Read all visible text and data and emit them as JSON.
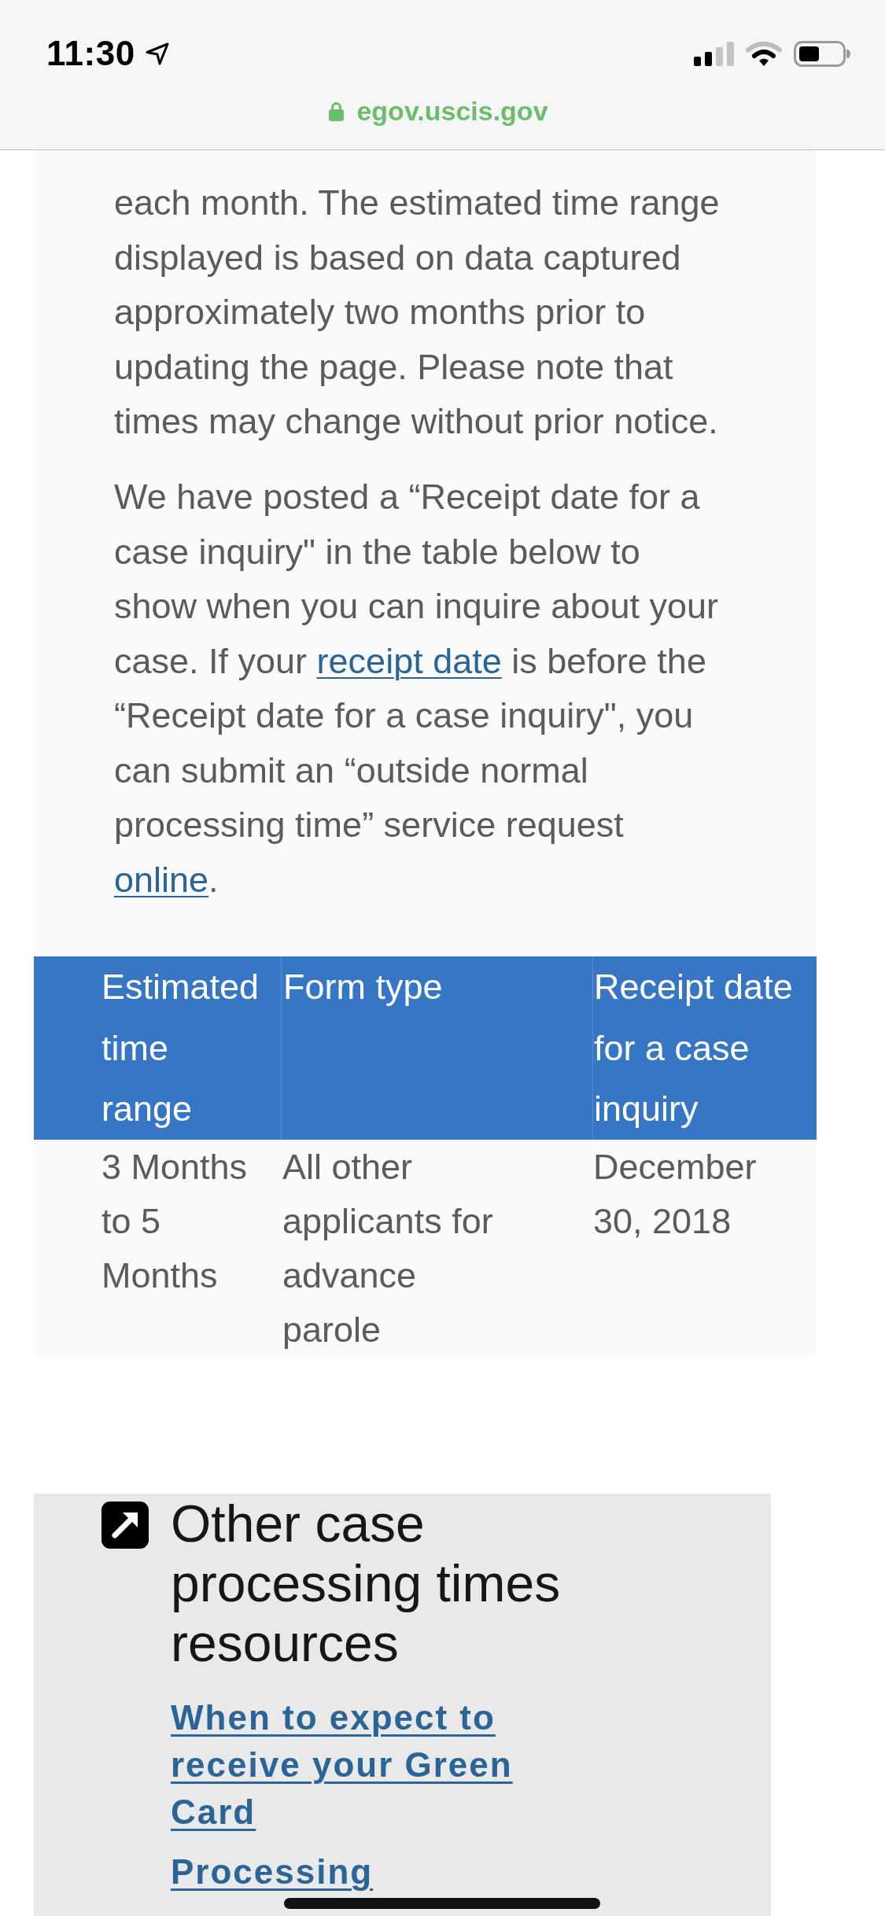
{
  "status_bar": {
    "time": "11:30"
  },
  "address_bar": {
    "url": "egov.uscis.gov"
  },
  "intro": {
    "paragraphs": [
      {
        "segments": [
          {
            "kind": "text",
            "text": "each month. The estimated time range displayed is based on data captured approximately two months prior to updating the page. Please note that times may change without prior notice."
          }
        ]
      },
      {
        "segments": [
          {
            "kind": "text",
            "text": "We have posted a “Receipt date for a case inquiry\" in the table below to show when you can inquire about your case. If your "
          },
          {
            "kind": "link",
            "text": "receipt date"
          },
          {
            "kind": "text",
            "text": " is before the “Receipt date for a case inquiry\", you can submit an “outside normal processing time” service request "
          },
          {
            "kind": "link",
            "text": "online"
          },
          {
            "kind": "text",
            "text": "."
          }
        ]
      }
    ]
  },
  "table": {
    "columns": [
      "Estimated time range",
      "Form type",
      "Receipt date for a case inquiry"
    ],
    "rows": [
      [
        "3 Months to 5 Months",
        "All other applicants for advance parole",
        "December 30, 2018"
      ]
    ]
  },
  "resources": {
    "title": "Other case processing times resources",
    "links": [
      "When to expect to receive your Green Card",
      "Processing"
    ]
  }
}
